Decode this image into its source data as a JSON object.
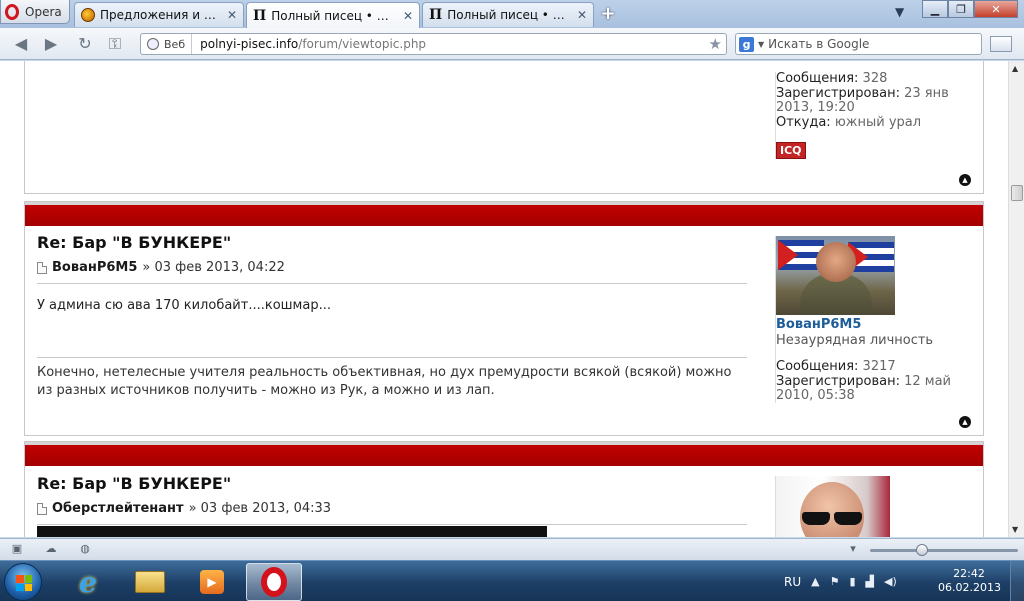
{
  "browser": {
    "menu_label": "Opera",
    "tabs": [
      {
        "label": "Предложения и обсу...",
        "icon": "globe-icon",
        "active": false
      },
      {
        "label": "Полный писец • Прос...",
        "icon": "pc-icon",
        "active": true
      },
      {
        "label": "Полный писец • Прос...",
        "icon": "pc-icon",
        "active": false
      }
    ],
    "new_tab_label": "+",
    "url_badge": "Веб",
    "url_host": "polnyi-pisec.info",
    "url_path": "/forum/viewtopic.php",
    "search_placeholder": "Искать в Google"
  },
  "posts": [
    {
      "profile": {
        "messages_label": "Сообщения:",
        "messages_value": "328",
        "registered_label": "Зарегистрирован:",
        "registered_value": "23 янв 2013, 19:20",
        "from_label": "Откуда:",
        "from_value": "южный урал",
        "icq_label": "ICQ"
      }
    },
    {
      "title": "Re: Бар \"В БУНКЕРЕ\"",
      "author": "ВованР6М5",
      "date": "» 03 фев 2013, 04:22",
      "content": "У админа сю ава 170 килобайт....кошмар...",
      "signature": "Конечно, нетелесные учителя реальность объективная, но дух премудрости всякой (всякой) можно из разных источников получить - можно из Рук, а можно и из лап.",
      "profile": {
        "name": "ВованР6М5",
        "rank": "Незаурядная личность",
        "messages_label": "Сообщения:",
        "messages_value": "3217",
        "registered_label": "Зарегистрирован:",
        "registered_value": "12 май 2010, 05:38"
      }
    },
    {
      "title": "Re: Бар \"В БУНКЕРЕ\"",
      "author": "Оберстлейтенант",
      "date": "» 03 фев 2013, 04:33"
    }
  ],
  "taskbar": {
    "language": "RU",
    "time": "22:42",
    "date": "06.02.2013"
  }
}
